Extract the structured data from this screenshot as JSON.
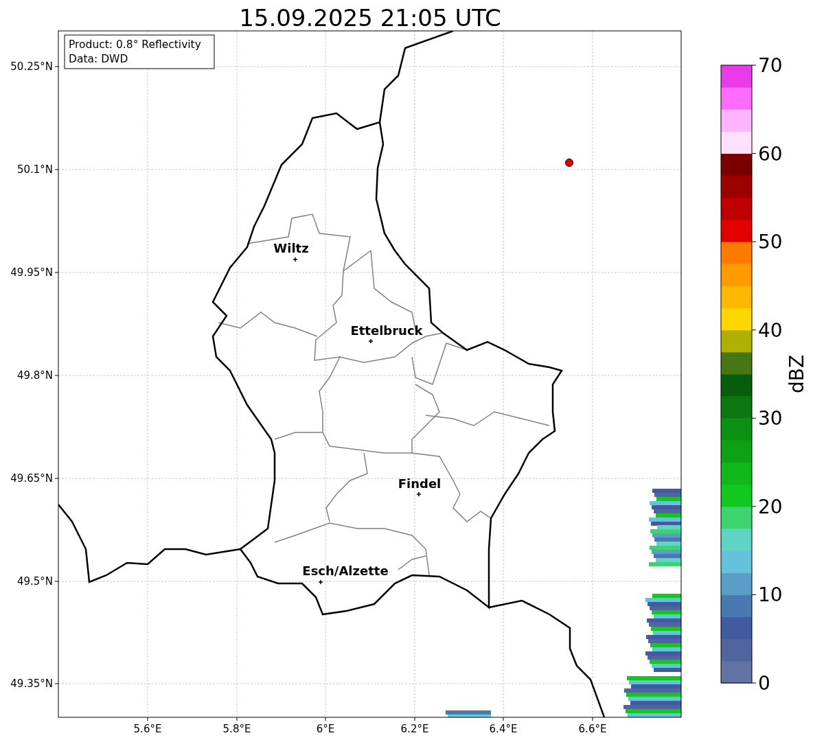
{
  "title": "15.09.2025 21:05 UTC",
  "info_box": {
    "lines": [
      "Product: 0.8° Reflectivity",
      "Data: DWD"
    ]
  },
  "map": {
    "x_tick_labels": [
      "5.6°E",
      "5.8°E",
      "6°E",
      "6.2°E",
      "6.4°E",
      "6.6°E"
    ],
    "y_tick_labels": [
      "50.25°N",
      "50.1°N",
      "49.95°N",
      "49.8°N",
      "49.65°N",
      "49.5°N",
      "49.35°N"
    ],
    "cities": [
      {
        "name": "Wiltz"
      },
      {
        "name": "Ettelbruck"
      },
      {
        "name": "Findel"
      },
      {
        "name": "Esch/Alzette"
      }
    ]
  },
  "colorbar": {
    "label": "dBZ",
    "tick_labels": [
      "70",
      "60",
      "50",
      "40",
      "30",
      "20",
      "10",
      "0"
    ],
    "bins": [
      {
        "color": "#6373a6"
      },
      {
        "color": "#52649e"
      },
      {
        "color": "#435aa0"
      },
      {
        "color": "#4a78b0"
      },
      {
        "color": "#5a9ec8"
      },
      {
        "color": "#66c2dc"
      },
      {
        "color": "#5fd6c4"
      },
      {
        "color": "#3dd470"
      },
      {
        "color": "#12c81e"
      },
      {
        "color": "#10b81a"
      },
      {
        "color": "#0fa115"
      },
      {
        "color": "#0c8f12"
      },
      {
        "color": "#0a7810"
      },
      {
        "color": "#065e0c"
      },
      {
        "color": "#467714"
      },
      {
        "color": "#b0b000"
      },
      {
        "color": "#ffd700"
      },
      {
        "color": "#ffb800"
      },
      {
        "color": "#ff9b00"
      },
      {
        "color": "#ff7b00"
      },
      {
        "color": "#e30000"
      },
      {
        "color": "#c00000"
      },
      {
        "color": "#9e0000"
      },
      {
        "color": "#7a0000"
      },
      {
        "color": "#ffe0ff"
      },
      {
        "color": "#ffb4ff"
      },
      {
        "color": "#ff6cff"
      },
      {
        "color": "#ea3aea"
      }
    ]
  }
}
